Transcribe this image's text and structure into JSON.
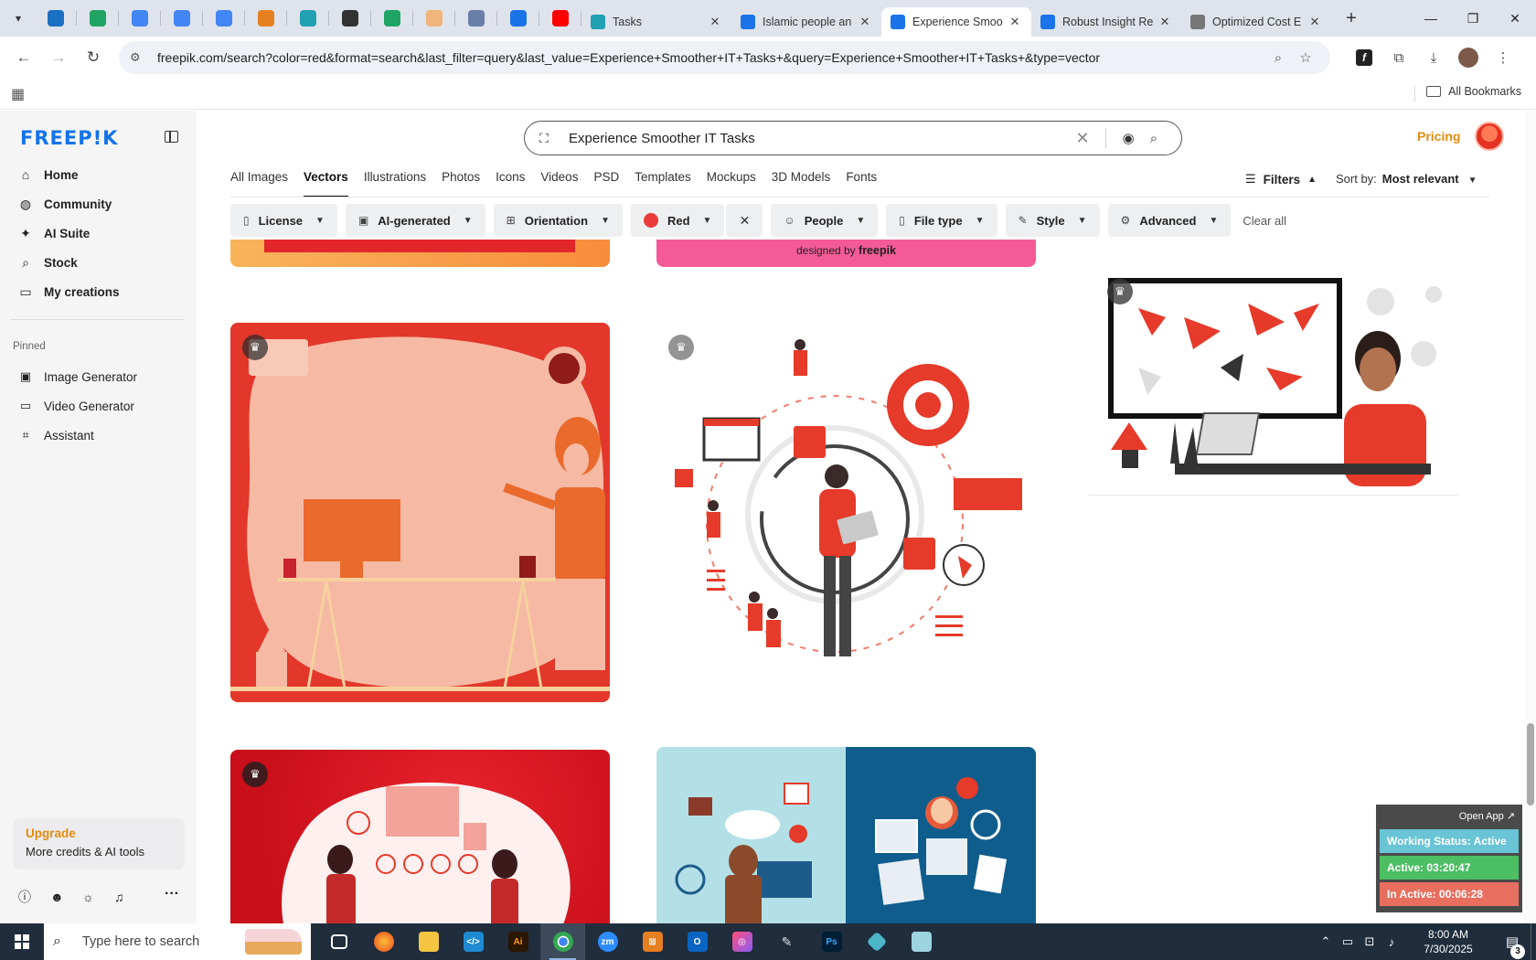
{
  "browser": {
    "pinned_tabs": [
      {
        "icon": "globe-icon",
        "color": "#1b6fc2"
      },
      {
        "icon": "sheets-icon",
        "color": "#1fa463"
      },
      {
        "icon": "docs-icon",
        "color": "#4285f4"
      },
      {
        "icon": "docs-icon",
        "color": "#4285f4"
      },
      {
        "icon": "docs-icon",
        "color": "#4285f4"
      },
      {
        "icon": "app-icon",
        "color": "#e67e22"
      },
      {
        "icon": "app-icon",
        "color": "#20a0b0"
      },
      {
        "icon": "openai-icon",
        "color": "#333333"
      },
      {
        "icon": "sheets-icon",
        "color": "#1fa463"
      },
      {
        "icon": "app-icon",
        "color": "#f0b57a"
      },
      {
        "icon": "app-icon",
        "color": "#6a7fa8"
      },
      {
        "icon": "docs-icon",
        "color": "#1a73e8"
      },
      {
        "icon": "youtube-icon",
        "color": "#ff0000"
      }
    ],
    "tabs": [
      {
        "title": "Tasks",
        "active": false
      },
      {
        "title": "Islamic people an",
        "active": false
      },
      {
        "title": "Experience Smoo",
        "active": true
      },
      {
        "title": "Robust Insight Re",
        "active": false
      },
      {
        "title": "Optimized Cost E",
        "active": false
      }
    ],
    "url": "freepik.com/search?color=red&format=search&last_filter=query&last_value=Experience+Smoother+IT+Tasks+&query=Experience+Smoother+IT+Tasks+&type=vector",
    "all_bookmarks": "All Bookmarks"
  },
  "sidebar": {
    "logo": "FREEP!K",
    "nav": [
      {
        "label": "Home",
        "icon": "home-icon"
      },
      {
        "label": "Community",
        "icon": "globe-icon"
      },
      {
        "label": "AI Suite",
        "icon": "sparkle-icon"
      },
      {
        "label": "Stock",
        "icon": "search-icon"
      },
      {
        "label": "My creations",
        "icon": "folder-icon"
      }
    ],
    "pinned_label": "Pinned",
    "pinned": [
      {
        "label": "Image Generator",
        "icon": "image-icon"
      },
      {
        "label": "Video Generator",
        "icon": "video-icon"
      },
      {
        "label": "Assistant",
        "icon": "assistant-icon"
      }
    ],
    "upgrade_title": "Upgrade",
    "upgrade_text": "More credits & AI tools"
  },
  "header": {
    "search_query": "Experience Smoother IT Tasks",
    "pricing": "Pricing",
    "type_tabs": [
      {
        "label": "All Images",
        "active": false
      },
      {
        "label": "Vectors",
        "active": true
      },
      {
        "label": "Illustrations",
        "active": false
      },
      {
        "label": "Photos",
        "active": false
      },
      {
        "label": "Icons",
        "active": false
      },
      {
        "label": "Videos",
        "active": false
      },
      {
        "label": "PSD",
        "active": false
      },
      {
        "label": "Templates",
        "active": false
      },
      {
        "label": "Mockups",
        "active": false
      },
      {
        "label": "3D Models",
        "active": false
      },
      {
        "label": "Fonts",
        "active": false
      }
    ],
    "filters_label": "Filters",
    "sort_label": "Sort by:",
    "sort_value": "Most relevant"
  },
  "filter_chips": {
    "license": "License",
    "ai_generated": "AI-generated",
    "orientation": "Orientation",
    "color": "Red",
    "people": "People",
    "file_type": "File type",
    "style": "Style",
    "advanced": "Advanced",
    "clear_all": "Clear all"
  },
  "grid": {
    "designed_by": "designed by",
    "brand": "freepik"
  },
  "widget": {
    "open_app": "Open App ↗",
    "working_status": "Working Status: Active",
    "active_time": "Active: 03:20:47",
    "inactive_time": "In Active: 00:06:28"
  },
  "taskbar": {
    "search_placeholder": "Type here to search",
    "time": "8:00 AM",
    "date": "7/30/2025",
    "notification_count": "3"
  }
}
